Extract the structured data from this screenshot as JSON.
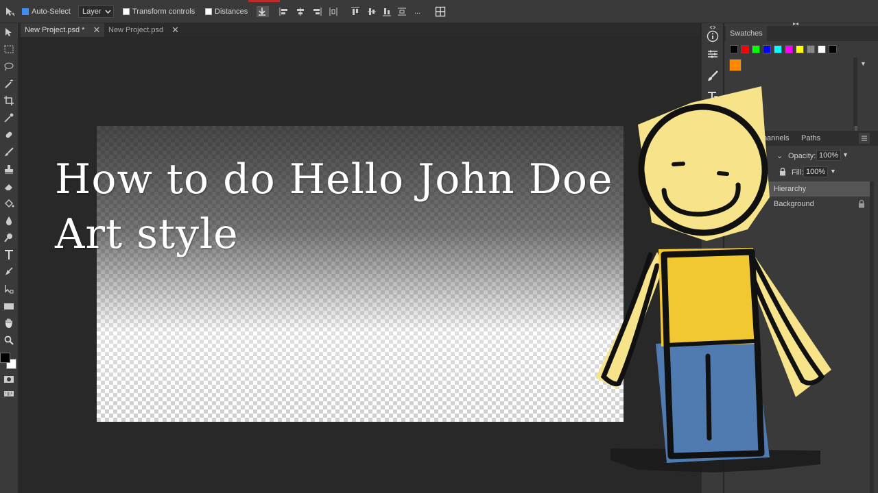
{
  "options_bar": {
    "auto_select_label": "Auto-Select",
    "layer_select_value": "Layer",
    "transform_controls_label": "Transform controls",
    "distances_label": "Distances",
    "more_label": "..."
  },
  "tabs": [
    {
      "label": "New Project.psd *"
    },
    {
      "label": "New Project.psd"
    }
  ],
  "thumbnail": {
    "line1": "How to do Hello John Doe",
    "line2": "Art style"
  },
  "swatches_panel": {
    "tab_label": "Swatches",
    "colors": [
      "#000000",
      "#ff0000",
      "#00ff00",
      "#0000ff",
      "#00ffff",
      "#ff00ff",
      "#ffff00",
      "#888888",
      "#ffffff",
      "#000000"
    ],
    "custom_color": "#ff8a00"
  },
  "layers_panel": {
    "tab_channels": "Channels",
    "tab_paths": "Paths",
    "opacity_label": "Opacity:",
    "opacity_value": "100%",
    "fill_label": "Fill:",
    "fill_value": "100%",
    "layers": [
      {
        "name": "Hierarchy"
      },
      {
        "name": "Background"
      }
    ]
  },
  "colors": {
    "accent_blue": "#3f8df2",
    "record_red": "#c12a2a",
    "character_yellow": "#f7e38a",
    "shirt_yellow": "#f2c832",
    "pants_blue": "#4f7bb0"
  },
  "icons": [
    "move-tool-icon",
    "marquee-tool-icon",
    "lasso-tool-icon",
    "magic-wand-icon",
    "crop-tool-icon",
    "eyedropper-icon",
    "healing-brush-icon",
    "brush-tool-icon",
    "clone-stamp-icon",
    "eraser-icon",
    "paint-bucket-icon",
    "blur-tool-icon",
    "dodge-tool-icon",
    "type-tool-icon",
    "pen-tool-icon",
    "path-select-icon",
    "rectangle-tool-icon",
    "hand-tool-icon",
    "zoom-tool-icon"
  ]
}
